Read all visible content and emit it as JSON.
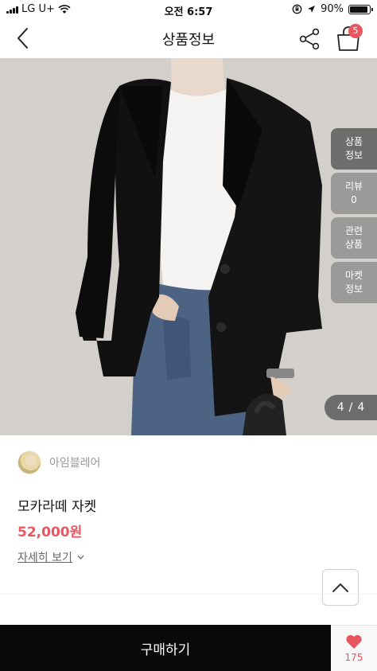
{
  "status_bar": {
    "carrier": "LG U+",
    "time": "오전 6:57",
    "battery": "90%",
    "battery_level": 0.9
  },
  "nav": {
    "title": "상품정보",
    "cart_count": "5",
    "icons": [
      "back-chevron-icon",
      "share-icon",
      "shopping-bag-icon"
    ]
  },
  "gallery": {
    "current": "4",
    "separator": "/",
    "total": "4"
  },
  "side_tabs": [
    {
      "line1": "상품",
      "line2": "정보"
    },
    {
      "line1": "리뷰",
      "line2": "0"
    },
    {
      "line1": "관련",
      "line2": "상품"
    },
    {
      "line1": "마켓",
      "line2": "정보"
    }
  ],
  "seller": {
    "name": "아임블레어"
  },
  "product": {
    "name": "모카라떼 자켓",
    "price": "52,000원",
    "detail_link": "자세히 보기"
  },
  "bottom_bar": {
    "buy_label": "구매하기",
    "like_count": "175"
  },
  "colors": {
    "accent": "#e8565f",
    "buy_bar": "#0a0a0a",
    "side_tab": "#9a9a9a",
    "side_tab_active": "#6e6e6e"
  }
}
